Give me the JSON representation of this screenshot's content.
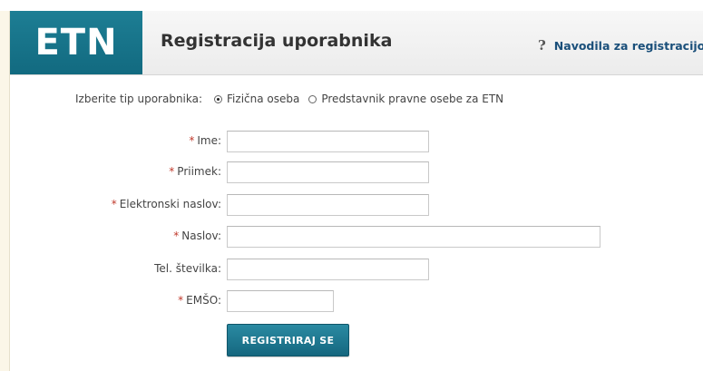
{
  "header": {
    "logo_text": "ETN",
    "title": "Registracija uporabnika",
    "help_icon": "question-mark-icon",
    "help_link": "Navodila za registracijo"
  },
  "user_type": {
    "label": "Izberite tip uporabnika:",
    "options": [
      {
        "label": "Fizična oseba",
        "selected": true
      },
      {
        "label": "Predstavnik pravne osebe za ETN",
        "selected": false
      }
    ]
  },
  "form": {
    "required_marker": "*",
    "fields": [
      {
        "label": "Ime:",
        "required": true,
        "value": ""
      },
      {
        "label": "Priimek:",
        "required": true,
        "value": ""
      },
      {
        "label": "Elektronski naslov:",
        "required": true,
        "value": ""
      },
      {
        "label": "Naslov:",
        "required": true,
        "value": ""
      },
      {
        "label": "Tel. številka:",
        "required": false,
        "value": ""
      },
      {
        "label": "EMŠO:",
        "required": true,
        "value": ""
      }
    ],
    "submit_label": "REGISTRIRAJ SE"
  },
  "colors": {
    "brand": "#17748b",
    "link": "#1a4f7a",
    "required": "#c0392b"
  }
}
